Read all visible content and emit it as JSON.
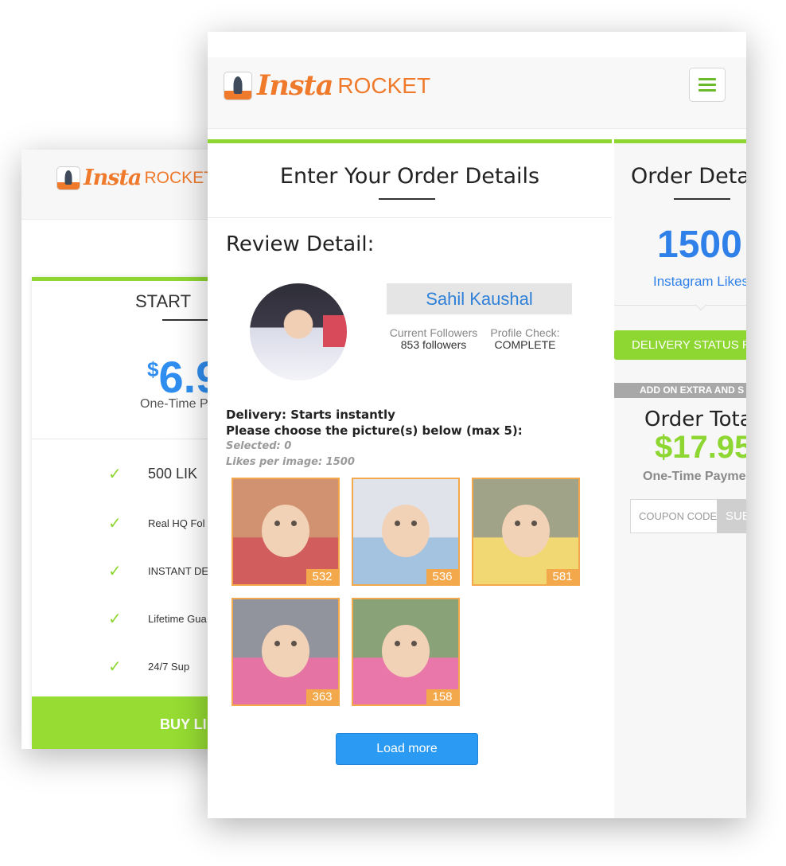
{
  "back_card": {
    "logo": {
      "insta": "Insta",
      "rocket": "ROCKET"
    },
    "plan_title": "START",
    "price": {
      "currency": "$",
      "amount": "6.9"
    },
    "one_time": "One-Time P",
    "features": [
      "500 LIK",
      "Real HQ Fol",
      "INSTANT DE",
      "Lifetime Gua",
      "24/7 Sup"
    ],
    "buy_label": "BUY LI"
  },
  "header": {
    "logo": {
      "insta": "Insta",
      "rocket": "ROCKET"
    }
  },
  "order_form": {
    "title": "Enter Your Order Details",
    "review_heading": "Review Detail:",
    "profile": {
      "name": "Sahil Kaushal",
      "followers_label": "Current Followers",
      "followers_value": "853 followers",
      "check_label": "Profile Check:",
      "check_value": "COMPLETE"
    },
    "delivery": "Delivery: Starts instantly",
    "choose_prompt": "Please choose the picture(s) below (max 5):",
    "selected": "Selected: 0",
    "likes_per_image": "Likes per image: 1500",
    "photos": [
      {
        "likes": "532",
        "bg": "#c77a52",
        "accent": "#c93a3a"
      },
      {
        "likes": "536",
        "bg": "#d9dde6",
        "accent": "#8fb6d9"
      },
      {
        "likes": "581",
        "bg": "#8d8f6e",
        "accent": "#efd055"
      },
      {
        "likes": "363",
        "bg": "#7a7d88",
        "accent": "#e0558f"
      },
      {
        "likes": "158",
        "bg": "#6f8e5a",
        "accent": "#e45a97"
      }
    ],
    "load_more": "Load more"
  },
  "order_details": {
    "title": "Order Deta",
    "quantity": "1500",
    "quantity_label": "Instagram Likes",
    "delivery_status": "DELIVERY STATUS RE",
    "addon": "ADD ON EXTRA AND S",
    "total_label": "Order Tota",
    "total": "$17.95",
    "one_time": "One-Time Payme",
    "coupon_placeholder": "COUPON CODE",
    "submit": "SUB"
  },
  "colors": {
    "accent_green": "#8ed632",
    "brand_orange": "#f07a2c",
    "link_blue": "#2f80e8",
    "thumb_border": "#f3a94b"
  }
}
